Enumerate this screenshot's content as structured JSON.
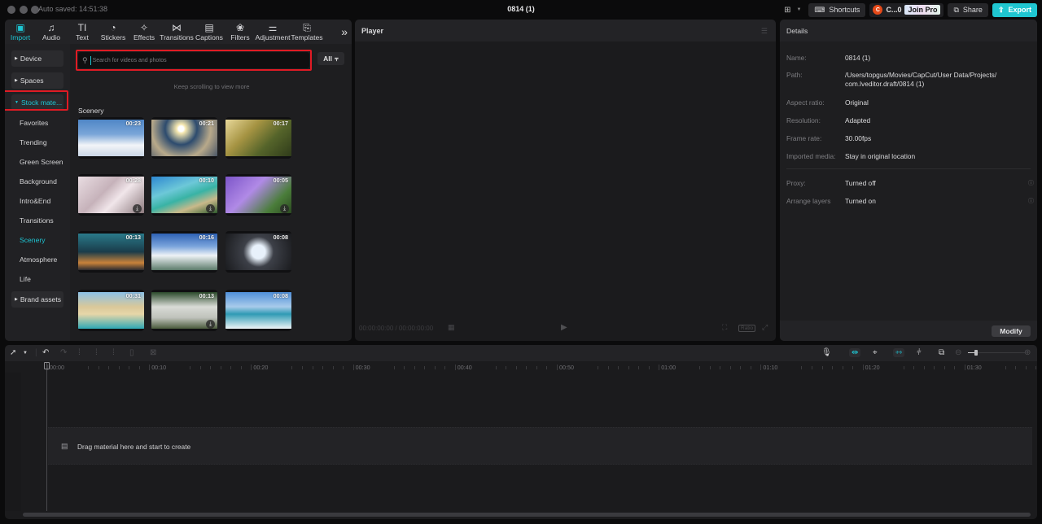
{
  "window": {
    "title": "0814 (1)",
    "autosave": "Auto saved: 14:51:38"
  },
  "topbar": {
    "layout_icon": "layout-icon",
    "shortcuts_label": "Shortcuts",
    "user_initial": "C",
    "user_name": "C...0",
    "join_pro_label": "Join Pro",
    "share_label": "Share",
    "export_label": "Export",
    "accent": "#1fc6d1"
  },
  "tools": [
    {
      "label": "Import",
      "icon": "import-icon",
      "glyph": "▣",
      "active": true
    },
    {
      "label": "Audio",
      "icon": "audio-icon",
      "glyph": "♫"
    },
    {
      "label": "Text",
      "icon": "text-icon",
      "glyph": "TI"
    },
    {
      "label": "Stickers",
      "icon": "stickers-icon",
      "glyph": "◔"
    },
    {
      "label": "Effects",
      "icon": "effects-icon",
      "glyph": "✧"
    },
    {
      "label": "Transitions",
      "icon": "transitions-icon",
      "glyph": "⋈"
    },
    {
      "label": "Captions",
      "icon": "captions-icon",
      "glyph": "▤"
    },
    {
      "label": "Filters",
      "icon": "filters-icon",
      "glyph": "❀"
    },
    {
      "label": "Adjustment",
      "icon": "adjustment-icon",
      "glyph": "⚌"
    },
    {
      "label": "Templates",
      "icon": "templates-icon",
      "glyph": "⎘"
    }
  ],
  "more_tools_glyph": "»",
  "sidebar": {
    "groups": [
      {
        "label": "Device"
      },
      {
        "label": "Spaces"
      },
      {
        "label": "Stock mate...",
        "active": true
      }
    ],
    "sub_items": [
      {
        "label": "Favorites"
      },
      {
        "label": "Trending"
      },
      {
        "label": "Green Screen"
      },
      {
        "label": "Background"
      },
      {
        "label": "Intro&End"
      },
      {
        "label": "Transitions"
      },
      {
        "label": "Scenery",
        "active": true
      },
      {
        "label": "Atmosphere"
      },
      {
        "label": "Life"
      }
    ],
    "brand_assets": "Brand assets"
  },
  "media": {
    "search_placeholder": "Search for videos and photos",
    "search_value": "",
    "filter_label": "All",
    "keep_scrolling": "Keep scrolling to view more",
    "section_title": "Scenery",
    "items": [
      {
        "duration": "00:23",
        "subject": "cumulus clouds blue sky",
        "download": false
      },
      {
        "duration": "00:21",
        "subject": "sun above sea of clouds",
        "download": false
      },
      {
        "duration": "00:17",
        "subject": "sunlit forest road aerial",
        "download": false
      },
      {
        "duration": "00:28",
        "subject": "cherry blossoms",
        "download": true
      },
      {
        "duration": "00:10",
        "subject": "tropical beach aerial",
        "download": true
      },
      {
        "duration": "00:05",
        "subject": "lavender field",
        "download": true
      },
      {
        "duration": "00:13",
        "subject": "city skyline dusk",
        "download": false
      },
      {
        "duration": "00:16",
        "subject": "clouds aerial",
        "download": false
      },
      {
        "duration": "00:08",
        "subject": "skyscrapers looking up",
        "download": false
      },
      {
        "duration": "00:31",
        "subject": "sandy coast beach",
        "download": false
      },
      {
        "duration": "00:13",
        "subject": "white grass flowers",
        "download": true
      },
      {
        "duration": "00:08",
        "subject": "ocean waves beach",
        "download": false
      }
    ]
  },
  "player": {
    "title": "Player",
    "timecode": "00:00:00:00 / 00:00:00:00",
    "ratio_label": "Ratio"
  },
  "details": {
    "title": "Details",
    "rows": [
      {
        "key": "Name:",
        "value": "0814 (1)"
      },
      {
        "key": "Path:",
        "value": "/Users/topgus/Movies/CapCut/User Data/Projects/ com.lveditor.draft/0814 (1)"
      },
      {
        "key": "Aspect ratio:",
        "value": "Original"
      },
      {
        "key": "Resolution:",
        "value": "Adapted"
      },
      {
        "key": "Frame rate:",
        "value": "30.00fps"
      },
      {
        "key": "Imported media:",
        "value": "Stay in original location"
      }
    ],
    "settings": [
      {
        "key": "Proxy:",
        "value": "Turned off"
      },
      {
        "key": "Arrange layers",
        "value": "Turned on"
      }
    ],
    "modify_label": "Modify"
  },
  "timeline": {
    "ticks": [
      "00:00",
      "00:10",
      "00:20",
      "00:30",
      "00:40",
      "00:50",
      "01:00",
      "01:10",
      "01:20",
      "01:30"
    ],
    "drop_hint": "Drag material here and start to create",
    "zoom_level": 0.12
  }
}
